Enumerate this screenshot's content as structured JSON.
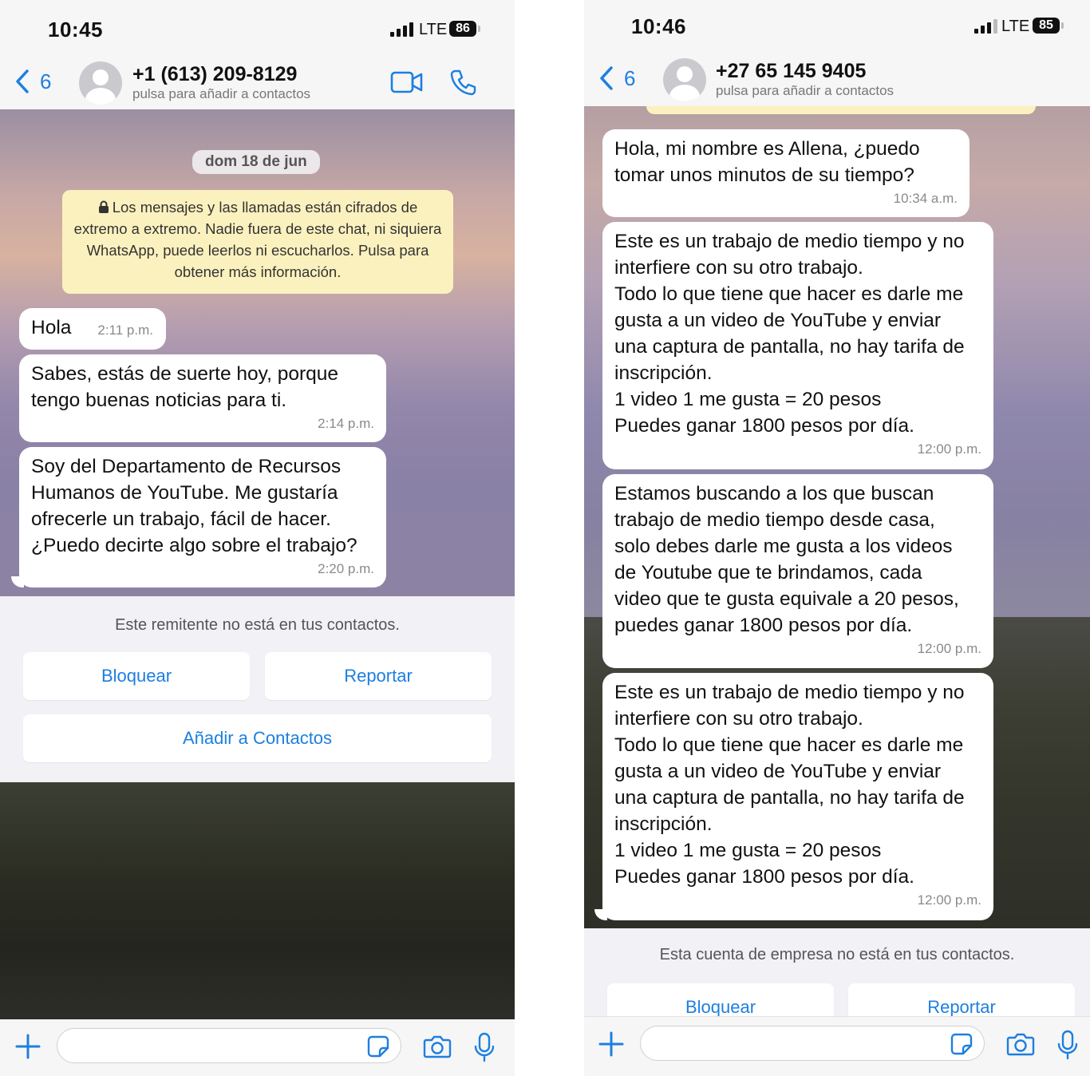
{
  "left": {
    "status": {
      "time": "10:45",
      "network": "LTE",
      "battery": "86"
    },
    "header": {
      "back_count": "6",
      "contact": "+1 (613) 209-8129",
      "subtitle": "pulsa para añadir a contactos"
    },
    "date_chip": "dom 18 de jun",
    "encryption_notice": "Los mensajes y las llamadas están cifrados de extremo a extremo. Nadie fuera de este chat, ni siquiera WhatsApp, puede leerlos ni escucharlos. Pulsa para obtener más información.",
    "messages": [
      {
        "text": "Hola",
        "time": "2:11 p.m."
      },
      {
        "text": "Sabes, estás de suerte hoy, porque\ntengo buenas noticias para ti.",
        "time": "2:14 p.m."
      },
      {
        "text": "Soy del Departamento de Recursos\nHumanos de YouTube. Me gustaría\nofrecerle un trabajo, fácil de hacer.\n¿Puedo decirte algo sobre el trabajo?",
        "time": "2:20 p.m."
      }
    ],
    "banner": {
      "text": "Este remitente no está en tus contactos.",
      "block": "Bloquear",
      "report": "Reportar",
      "add": "Añadir a Contactos"
    }
  },
  "right": {
    "status": {
      "time": "10:46",
      "network": "LTE",
      "battery": "85"
    },
    "header": {
      "back_count": "6",
      "contact": "+27 65 145 9405",
      "subtitle": "pulsa para añadir a contactos"
    },
    "messages": [
      {
        "text": "Hola, mi nombre es Allena, ¿puedo\ntomar unos minutos de su tiempo?",
        "time": "10:34 a.m."
      },
      {
        "text": "Este es un trabajo de medio tiempo y no\ninterfiere con su otro trabajo.\nTodo lo que tiene que hacer es darle me\ngusta a un video de YouTube y enviar\nuna captura de pantalla, no hay tarifa de\ninscripción.\n1 video 1 me gusta = 20 pesos\nPuedes ganar 1800 pesos por día.",
        "time": "12:00 p.m."
      },
      {
        "text": "Estamos buscando a los que buscan\ntrabajo de medio tiempo desde casa,\nsolo debes darle me gusta a los videos\nde Youtube que te brindamos, cada\nvideo que te gusta equivale a 20 pesos,\npuedes ganar 1800 pesos por día.",
        "time": "12:00 p.m."
      },
      {
        "text": "Este es un trabajo de medio tiempo y no\ninterfiere con su otro trabajo.\nTodo lo que tiene que hacer es darle me\ngusta a un video de YouTube y enviar\nuna captura de pantalla, no hay tarifa de\ninscripción.\n1 video 1 me gusta = 20 pesos\nPuedes ganar 1800 pesos por día.",
        "time": "12:00 p.m."
      }
    ],
    "banner": {
      "text": "Esta cuenta de empresa no está en tus contactos.",
      "block": "Bloquear",
      "report": "Reportar"
    }
  },
  "colors": {
    "accent": "#1d7fe0",
    "bubble": "#ffffff",
    "notice": "#fbf1be",
    "banner_bg": "#f2f1f5"
  },
  "icons": [
    "chevron-left-icon",
    "avatar-icon",
    "video-call-icon",
    "phone-icon",
    "lock-icon",
    "plus-icon",
    "sticker-icon",
    "camera-icon",
    "microphone-icon"
  ]
}
